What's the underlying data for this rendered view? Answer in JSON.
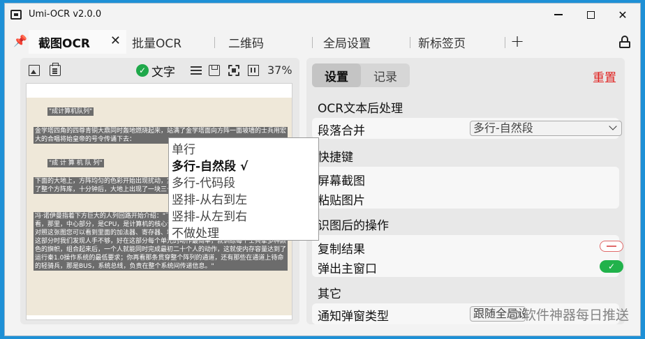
{
  "window": {
    "title": "Umi-OCR v2.0.0"
  },
  "tabs": [
    {
      "label": "截图OCR",
      "active": true
    },
    {
      "label": "批量OCR"
    },
    {
      "label": "二维码"
    },
    {
      "label": "全局设置"
    },
    {
      "label": "新标签页"
    }
  ],
  "tab_add_label": "+",
  "left_toolbar": {
    "text_toggle_label": "文字",
    "zoom": "37%"
  },
  "document": {
    "lines": [
      "\"成计算机队列\"",
      "金学塔四角的四尊青铜大鼎同时轰地燃烧起来，站满了金学塔面向方阵一面坡墙的士兵用宏大的合唱将始皇帝的号令传诵下去：",
      "\"成 计 算 机 队 列\"",
      "下面的大地上，方阵均匀的色彩开始出现扰动，复杂精细的回路结构浮现出来，并渐渐充满了整个方阵库，十分钟后，大地上出现了一块三十六平方公里的计算机主板。",
      "冯·诺伊曼指着下方巨大的人列回路开始介绍：\"下，我们把这台计算机命名为\"秦一号\"，请看，那里，中心部分，是CPU，是计算机的核心计算元件，由您最精锐的五个军团构成，对照这张图您可以看到里面的加法器、寄存器、堆栈存贮器；外围整齐的部分是内存，构建这部分时我们发现人手不够，好在这部分每个单元的动作最简单，就训练每个士兵拿多种颜色的旗帜，组合起来后，一个人就能同时完成最初二十个人的动作，这就使内存容量达到了运行秦1.0操作系统的最低要求；你再看那条贯穿整个阵列的通道，还有那些在通道上待命的轻骑兵，那是BUS，系统总线，负责在整个系统间传递信息。\""
    ]
  },
  "right_tabs": [
    {
      "label": "设置",
      "active": true
    },
    {
      "label": "记录"
    }
  ],
  "reset_label": "重置",
  "sections": {
    "ocr_post": "OCR文本后处理",
    "shortcuts": "快捷键",
    "after_ocr": "识图后的操作",
    "other": "其它"
  },
  "settings": {
    "paragraph_merge_label": "段落合并",
    "paragraph_merge_value": "多行-自然段",
    "screenshot_label": "屏幕截图",
    "paste_image_label": "粘贴图片",
    "copy_result_label": "复制结果",
    "popup_main_label": "弹出主窗口",
    "notify_type_label": "通知弹窗类型",
    "notify_type_value": "跟随全局设置"
  },
  "dropdown_options": [
    {
      "label": "单行"
    },
    {
      "label": "多行-自然段 √",
      "selected": true
    },
    {
      "label": "多行-代码段"
    },
    {
      "label": "竖排-从右到左"
    },
    {
      "label": "竖排-从左到右"
    },
    {
      "label": "不做处理"
    }
  ],
  "switches": {
    "copy_result": false,
    "popup_main": true,
    "on_glyph": "✓"
  },
  "watermark": "软件神器每日推送",
  "colors": {
    "accent_green": "#21b24b",
    "reset_red": "#e0201e",
    "background_blue": "#1e90d6"
  }
}
